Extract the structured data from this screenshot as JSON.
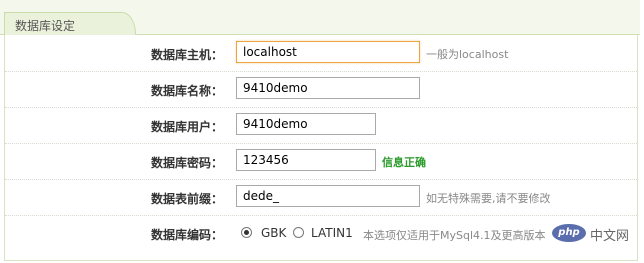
{
  "section": {
    "title": "数据库设定"
  },
  "fields": {
    "host": {
      "label": "数据库主机：",
      "value": "localhost",
      "hint": "一般为localhost"
    },
    "name": {
      "label": "数据库名称：",
      "value": "9410demo"
    },
    "user": {
      "label": "数据库用户：",
      "value": "9410demo"
    },
    "pass": {
      "label": "数据库密码：",
      "value": "123456",
      "hint": "信息正确"
    },
    "prefix": {
      "label": "数据表前缀：",
      "value": "dede_",
      "hint": "如无特殊需要,请不要修改"
    },
    "charset": {
      "label": "数据库编码：",
      "options": [
        "GBK",
        "LATIN1"
      ],
      "selected": "GBK",
      "hint": "本选项仅适用于MySql4.1及更高版本"
    }
  },
  "watermark": {
    "logo_text": "php",
    "text": "中文网"
  },
  "colors": {
    "hint_ok": "#2a9a2a",
    "focus_border": "#f0a640",
    "tab_bg": "#eaf2dc"
  }
}
